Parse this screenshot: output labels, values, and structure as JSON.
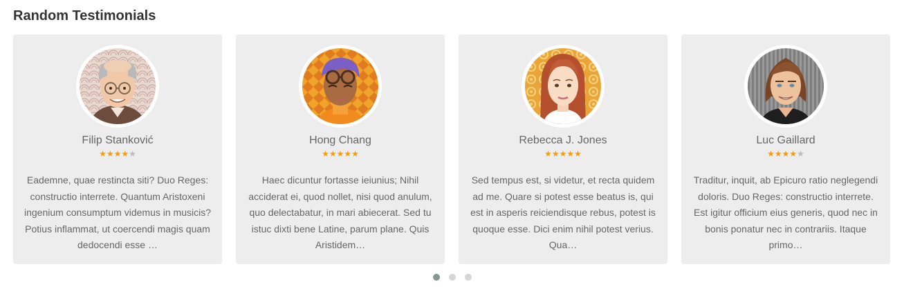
{
  "widget": {
    "title": "Random Testimonials"
  },
  "testimonials": [
    {
      "name": "Filip Stanković",
      "rating": 4,
      "max_rating": 5,
      "quote": "Eademne, quae restincta siti? Duo Reges: constructio interrete. Quantum Aristoxeni ingenium consumptum videmus in musicis? Potius inflammat, ut coercendi magis quam dedocendi esse …",
      "avatar_icon": "elderly-man-glasses-avatar"
    },
    {
      "name": "Hong Chang",
      "rating": 5,
      "max_rating": 5,
      "quote": "Haec dicuntur fortasse ieiunius; Nihil acciderat ei, quod nollet, nisi quod anulum, quo delectabatur, in mari abiecerat. Sed tu istuc dixti bene Latine, parum plane. Quis Aristidem…",
      "avatar_icon": "purple-hair-glasses-avatar"
    },
    {
      "name": "Rebecca J. Jones",
      "rating": 5,
      "max_rating": 5,
      "quote": "Sed tempus est, si videtur, et recta quidem ad me. Quare si potest esse beatus is, qui est in asperis reiciendisque rebus, potest is quoque esse. Dici enim nihil potest verius. Qua…",
      "avatar_icon": "red-hair-woman-avatar"
    },
    {
      "name": "Luc Gaillard",
      "rating": 4,
      "max_rating": 5,
      "quote": "Traditur, inquit, ab Epicuro ratio neglegendi doloris. Duo Reges: constructio interrete. Est igitur officium eius generis, quod nec in bonis ponatur nec in contrariis. Itaque primo…",
      "avatar_icon": "long-hair-man-avatar"
    }
  ],
  "pagination": {
    "pages": 3,
    "active": 1
  },
  "colors": {
    "card_bg": "#ededed",
    "star_on": "#f39c12",
    "star_off": "#bbbbbb",
    "dot_active": "#869791",
    "dot_inactive": "#d6d6d6"
  }
}
